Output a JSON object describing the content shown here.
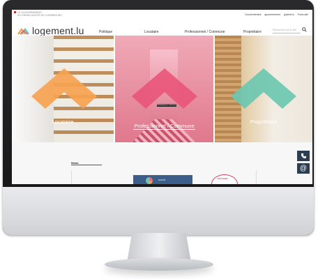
{
  "gov": {
    "line1": "LE GOUVERNEMENT",
    "line2": "DU GRAND-DUCHÉ DE LUXEMBOURG"
  },
  "toplinks": [
    "Gouvernement",
    "gouvernement",
    "guichet.lu",
    "Funio.site"
  ],
  "logo": {
    "text": "logement.lu"
  },
  "nav": [
    "Politique",
    "Locataire",
    "Professionnel / Commune",
    "Propriétaire"
  ],
  "search": {
    "placeholder": "Rechercher sur le site"
  },
  "hero": [
    {
      "label": "Locataire",
      "chevron_color": "#f6a350"
    },
    {
      "label": "Professionnel / Commune",
      "chevron_color": "#e9557a",
      "caption": "Professionnel / Commune"
    },
    {
      "label": "Propriétaire",
      "chevron_color": "#6cc7b0"
    }
  ],
  "news": {
    "title": "News"
  },
  "card": {
    "text": "SANTÉ"
  },
  "badge": {
    "text": "LOCATION"
  },
  "side": {
    "phone_icon": "phone-icon",
    "email_icon": "at-icon"
  },
  "colors": {
    "accent_orange": "#f6a350",
    "accent_pink": "#e9557a",
    "accent_teal": "#6cc7b0",
    "side_bg": "#2c3e50"
  }
}
